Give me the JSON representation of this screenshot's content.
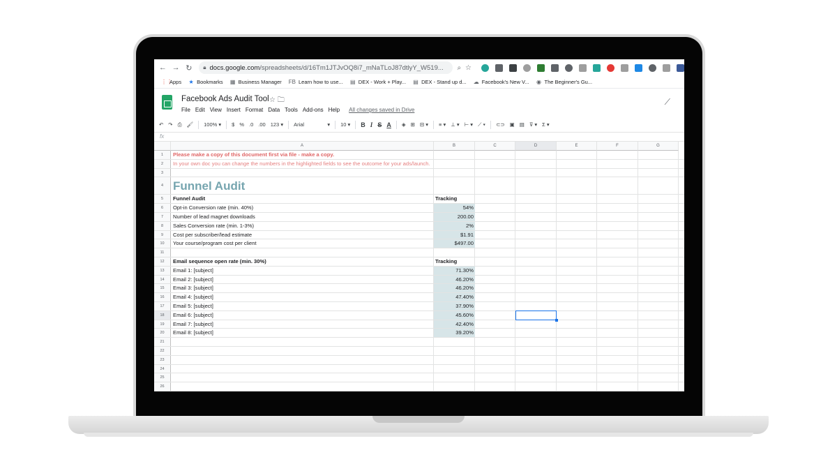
{
  "browser": {
    "url_host": "docs.google.com",
    "url_path": "/spreadsheets/d/16Tm1JTJvOQ8i7_mNaTLoJ87dtlyY_W519...",
    "bookmarks": [
      {
        "label": "Apps",
        "icon": "apps-grid-icon"
      },
      {
        "label": "Bookmarks",
        "icon": "star-icon"
      },
      {
        "label": "Business Manager",
        "icon": "business-icon"
      },
      {
        "label": "Learn how to use...",
        "icon": "fb-icon",
        "prefix": "FB"
      },
      {
        "label": "DEX - Work + Play...",
        "icon": "page-icon"
      },
      {
        "label": "DEX - Stand up d...",
        "icon": "page-icon"
      },
      {
        "label": "Facebook's New V...",
        "icon": "cloud-icon"
      },
      {
        "label": "The Beginner's Gu...",
        "icon": "circle-icon"
      }
    ],
    "extension_colors": [
      "#26a69a",
      "#5f6368",
      "#3c4043",
      "#9e9e9e",
      "#2e7d32",
      "#5f6368",
      "#5f6368",
      "#9e9e9e",
      "#26a69a",
      "#e53935",
      "#9e9e9e",
      "#1e88e5",
      "#5f6368",
      "#9e9e9e",
      "#3b5998"
    ]
  },
  "sheet": {
    "title": "Facebook Ads Audit Tool",
    "menu": [
      "File",
      "Edit",
      "View",
      "Insert",
      "Format",
      "Data",
      "Tools",
      "Add-ons",
      "Help"
    ],
    "saved_status": "All changes saved in Drive",
    "zoom": "100%",
    "font": "Arial",
    "font_size": "10",
    "formula_icon": "fx",
    "columns": [
      "A",
      "B",
      "C",
      "D",
      "E",
      "F",
      "G"
    ],
    "selected_column": "D",
    "selected_row": "18"
  },
  "rows": [
    {
      "n": "1",
      "a": "Please make a copy of this document first via file - make a copy.",
      "b": "",
      "style": "red"
    },
    {
      "n": "2",
      "a": "In your own doc you can change the numbers in the highlighted fields to see the outcome for your ads/launch.",
      "b": "",
      "style": "pink"
    },
    {
      "n": "3",
      "a": "",
      "b": ""
    },
    {
      "n": "4",
      "a": "Funnel Audit",
      "b": "",
      "style": "big"
    },
    {
      "n": "5",
      "a": "Funnel Audit",
      "b": "Tracking",
      "style": "bold"
    },
    {
      "n": "6",
      "a": "Opt-in Conversion rate (min. 40%)",
      "b": "54%",
      "hl": true
    },
    {
      "n": "7",
      "a": "Number of lead magnet downloads",
      "b": "200.00",
      "hl": true
    },
    {
      "n": "8",
      "a": "Sales Conversion rate (min. 1-3%)",
      "b": "2%",
      "hl": true
    },
    {
      "n": "9",
      "a": "Cost per subscriber/lead estimate",
      "b": "$1.91",
      "hl": true
    },
    {
      "n": "10",
      "a": "Your course/program cost per client",
      "b": "$497.00",
      "hl": true
    },
    {
      "n": "11",
      "a": "",
      "b": ""
    },
    {
      "n": "12",
      "a": "Email sequence open rate (min. 30%)",
      "b": "Tracking",
      "style": "bold"
    },
    {
      "n": "13",
      "a": "Email 1: [subject]",
      "b": "71.30%",
      "hl": true
    },
    {
      "n": "14",
      "a": "Email 2: [subject]",
      "b": "46.20%",
      "hl": true
    },
    {
      "n": "15",
      "a": "Email 3: [subject]",
      "b": "46.20%",
      "hl": true
    },
    {
      "n": "16",
      "a": "Email 4: [subject]",
      "b": "47.40%",
      "hl": true
    },
    {
      "n": "17",
      "a": "Email 5: [subject]",
      "b": "37.90%",
      "hl": true
    },
    {
      "n": "18",
      "a": "Email 6: [subject]",
      "b": "45.60%",
      "hl": true
    },
    {
      "n": "19",
      "a": "Email 7: [subject]",
      "b": "42.40%",
      "hl": true
    },
    {
      "n": "20",
      "a": "Email 8: [subject]",
      "b": "39.20%",
      "hl": true
    },
    {
      "n": "21",
      "a": "",
      "b": ""
    },
    {
      "n": "22",
      "a": "",
      "b": ""
    },
    {
      "n": "23",
      "a": "",
      "b": ""
    },
    {
      "n": "24",
      "a": "",
      "b": ""
    },
    {
      "n": "25",
      "a": "",
      "b": ""
    },
    {
      "n": "26",
      "a": "",
      "b": ""
    }
  ]
}
